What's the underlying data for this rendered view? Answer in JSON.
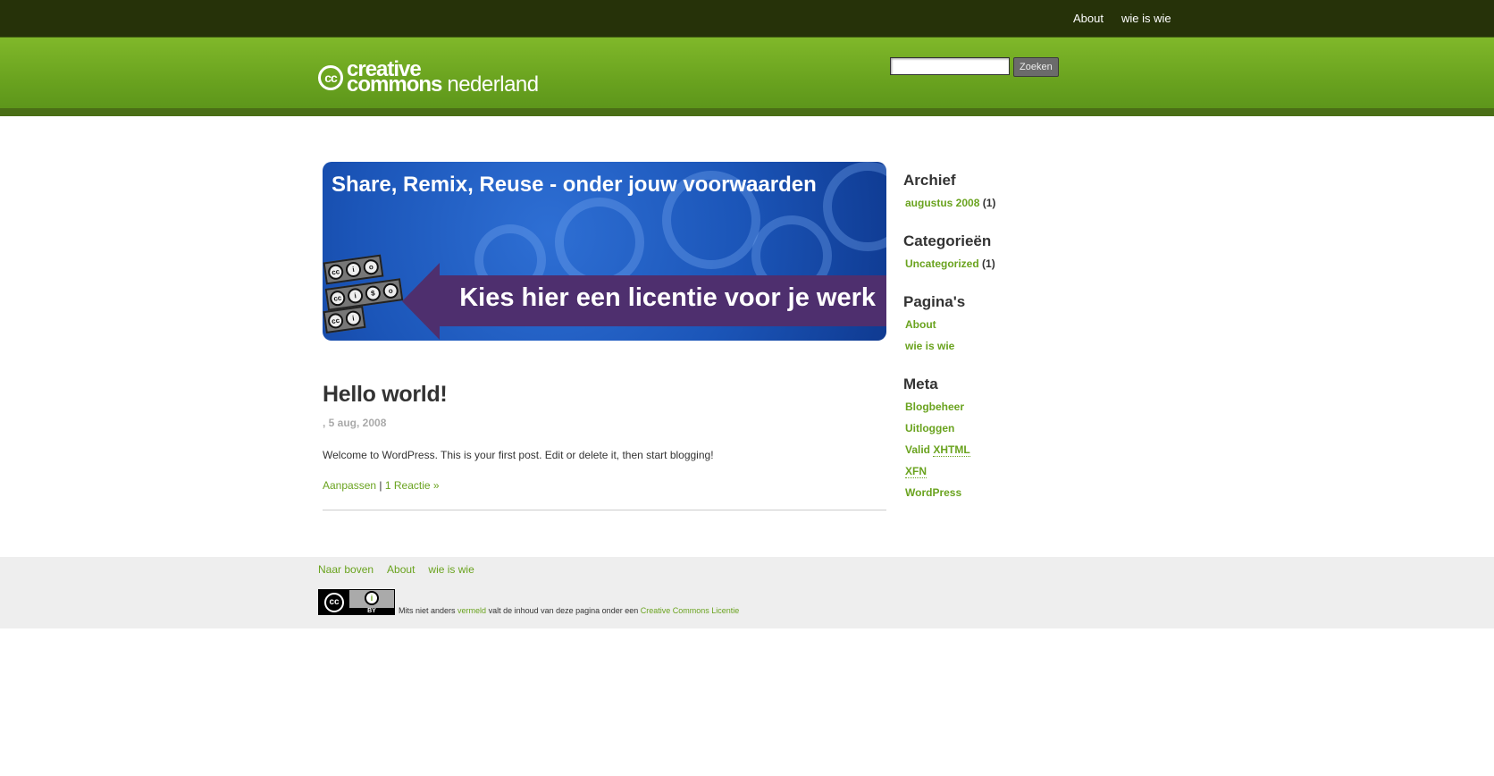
{
  "topnav": {
    "items": [
      "About",
      "wie is wie"
    ]
  },
  "logo": {
    "cc": "cc",
    "word1": "creative",
    "word2": "commons",
    "word3": "nederland"
  },
  "search": {
    "value": "",
    "button_label": "Zoeken"
  },
  "banner": {
    "title": "Share, Remix, Reuse - onder jouw voorwaarden",
    "cta": "Kies hier een licentie voor je werk"
  },
  "post": {
    "title": "Hello world!",
    "meta": ", 5 aug, 2008",
    "body": "Welcome to WordPress. This is your first post. Edit or delete it, then start blogging!",
    "edit_link": "Aanpassen",
    "separator": "|",
    "comments_link": "1 Reactie »"
  },
  "sidebar": {
    "archief": {
      "title": "Archief",
      "items": [
        {
          "label": "augustus 2008",
          "count": "(1)"
        }
      ]
    },
    "categorieen": {
      "title": "Categorieën",
      "items": [
        {
          "label": "Uncategorized",
          "count": "(1)"
        }
      ]
    },
    "paginas": {
      "title": "Pagina's",
      "items": [
        "About",
        "wie is wie"
      ]
    },
    "meta": {
      "title": "Meta",
      "items": [
        "Blogbeheer",
        "Uitloggen",
        "Valid",
        "XHTML",
        "XFN",
        "WordPress"
      ]
    }
  },
  "footer": {
    "nav": [
      "Naar boven",
      "About",
      "wie is wie"
    ],
    "license": {
      "badge_cc": "cc",
      "badge_by": "BY",
      "text1": "Mits niet anders",
      "link1": "vermeld",
      "text2": "valt de inhoud van deze pagina onder een",
      "link2": "Creative Commons Licentie"
    }
  },
  "colors": {
    "link": "#6aa31f",
    "topbar": "#263209",
    "header": "#6aa31f",
    "banner": "#1b55b8",
    "banner_strip": "#4e2f6e"
  }
}
